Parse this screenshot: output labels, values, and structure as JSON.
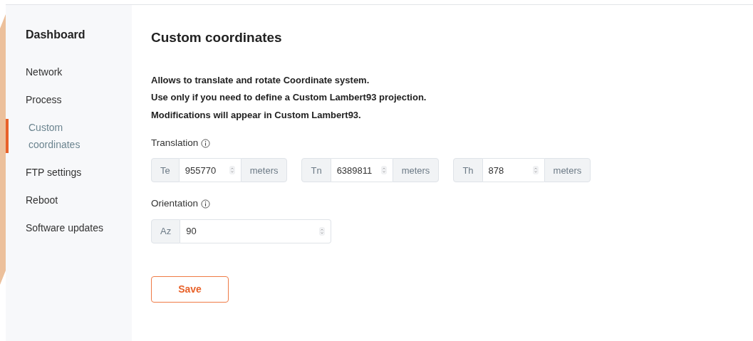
{
  "sidebar": {
    "title": "Dashboard",
    "items": [
      {
        "label": "Network",
        "selected": false
      },
      {
        "label": "Process",
        "selected": false
      },
      {
        "label": "Custom coordinates",
        "selected": true
      },
      {
        "label": "FTP settings",
        "selected": false
      },
      {
        "label": "Reboot",
        "selected": false
      },
      {
        "label": "Software updates",
        "selected": false
      }
    ]
  },
  "page": {
    "title": "Custom coordinates",
    "description": [
      "Allows to translate and rotate Coordinate system.",
      "Use only if you need to define a Custom Lambert93 projection.",
      "Modifications will appear in Custom Lambert93."
    ],
    "sections": [
      {
        "label": "Translation",
        "fields": [
          {
            "prefix": "Te",
            "value": "955770",
            "suffix": "meters"
          },
          {
            "prefix": "Tn",
            "value": "6389811",
            "suffix": "meters"
          },
          {
            "prefix": "Th",
            "value": "878",
            "suffix": "meters"
          }
        ]
      },
      {
        "label": "Orientation",
        "fields": [
          {
            "prefix": "Az",
            "value": "90"
          }
        ]
      }
    ],
    "save_button": "Save"
  }
}
